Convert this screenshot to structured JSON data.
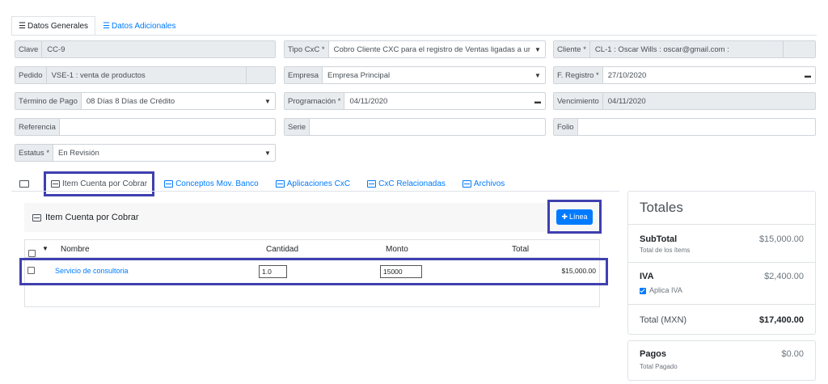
{
  "tabs": {
    "general": "Datos Generales",
    "adicionales": "Datos Adicionales"
  },
  "form": {
    "clave": {
      "label": "Clave",
      "value": "CC-9"
    },
    "tipo_cxc": {
      "label": "Tipo CxC *",
      "value": "Cobro Cliente CXC para el registro de Ventas ligadas a un"
    },
    "cliente": {
      "label": "Cliente *",
      "value": "CL-1 : Oscar Wills  : oscar@gmail.com  :"
    },
    "pedido": {
      "label": "Pedido",
      "value": "VSE-1 : venta de productos"
    },
    "empresa": {
      "label": "Empresa",
      "value": "Empresa Principal"
    },
    "f_registro": {
      "label": "F. Registro *",
      "value": "27/10/2020"
    },
    "termino_pago": {
      "label": "Término de Pago",
      "value": "08 Días 8 Días de Crédito"
    },
    "programacion": {
      "label": "Programación *",
      "value": "04/11/2020"
    },
    "vencimiento": {
      "label": "Vencimiento",
      "value": "04/11/2020"
    },
    "referencia": {
      "label": "Referencia",
      "value": ""
    },
    "serie": {
      "label": "Serie",
      "value": ""
    },
    "folio": {
      "label": "Folio",
      "value": ""
    },
    "estatus": {
      "label": "Estatus *",
      "value": "En Revisión"
    }
  },
  "subtabs": [
    "Item Cuenta por Cobrar",
    "Conceptos Mov. Banco",
    "Aplicaciones CxC",
    "CxC Relacionadas",
    "Archivos"
  ],
  "items_card": {
    "title": "Item Cuenta por Cobrar",
    "add_button": "Línea",
    "columns": {
      "nombre": "Nombre",
      "cantidad": "Cantidad",
      "monto": "Monto",
      "total": "Total"
    },
    "rows": [
      {
        "nombre": "Servicio de consultoria",
        "cantidad": "1.0",
        "monto": "15000",
        "total": "$15,000.00"
      }
    ]
  },
  "totals": {
    "title": "Totales",
    "subtotal": {
      "label": "SubTotal",
      "sub": "Total de los ítems",
      "value": "$15,000.00"
    },
    "iva": {
      "label": "IVA",
      "check_label": "Aplica IVA",
      "value": "$2,400.00"
    },
    "total": {
      "label": "Total (MXN)",
      "value": "$17,400.00"
    },
    "pagos": {
      "label": "Pagos",
      "sub": "Total Pagado",
      "value": "$0.00"
    }
  },
  "colors": {
    "accent": "#007bff",
    "highlight": "#3f3fb0"
  }
}
